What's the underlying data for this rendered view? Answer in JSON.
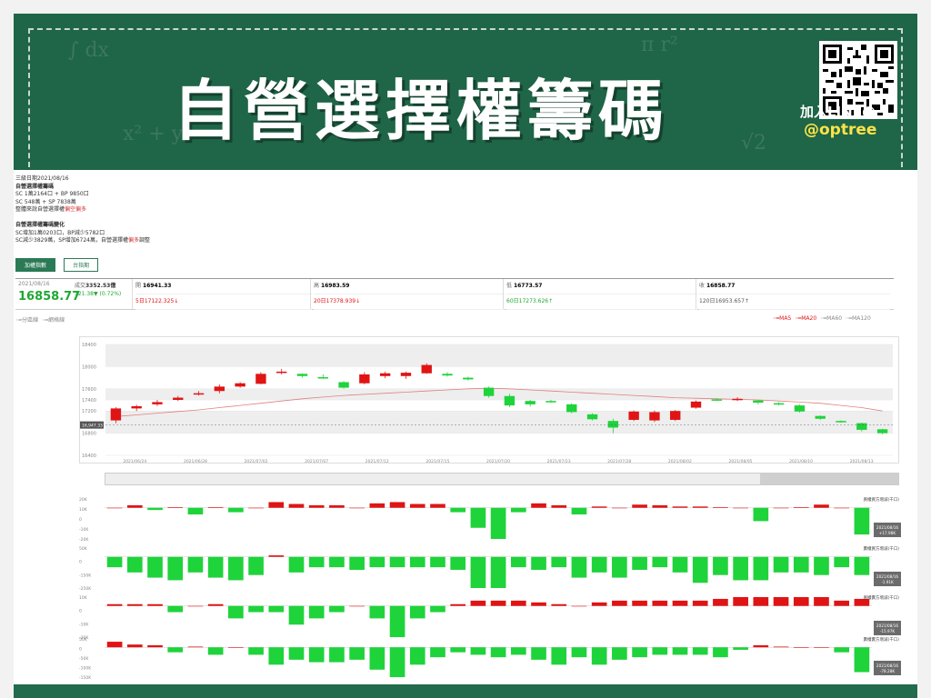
{
  "banner": {
    "title": "自營選擇權籌碼",
    "line_label": "加入LINE@",
    "line_id": "@optree"
  },
  "notes": {
    "date_line": "三級日期2021/08/16",
    "section1_title": "自營選擇權籌碼",
    "line_a": "SC 1萬2164口 + BP 9850口",
    "line_b": "SC 548萬 + SP 7838萬",
    "line_c_prefix": "整體來說自營選擇權",
    "line_c_red": "偏空偏多",
    "section2_title": "自營選擇權籌碼變化",
    "line_d": "SC增加1萬0203口，BP減少5782口",
    "line_e_prefix": "SC減少3829萬，SP增加6724萬，自營選擇權",
    "line_e_red": "偏多",
    "line_e_suffix": "調整"
  },
  "tabs": [
    "加權指數",
    "台指期"
  ],
  "stats": {
    "date": "2021/08/16",
    "price": "16858.77",
    "volume_label": "成交",
    "volume": "3352.53億",
    "change": "121.38▼ (0.72%)",
    "open_label": "開",
    "open": "16941.33",
    "high_label": "高",
    "high": "16983.59",
    "low_label": "低",
    "low": "16773.57",
    "close_label": "收",
    "close": "16858.77",
    "ma5": "5日17122.325↓",
    "ma20": "20日17378.939↓",
    "ma60": "60日17273.626↑",
    "ma120": "120日16953.657↑"
  },
  "toggles": {
    "left": [
      "分區線",
      "網格線"
    ],
    "right": [
      "MA5",
      "MA20",
      "MA60",
      "MA120"
    ]
  },
  "colors": {
    "up": "#e01414",
    "down": "#1fd33b",
    "ma": "#e08080",
    "brand": "#1f6547",
    "highlight": "#ffe347"
  },
  "chart_data": [
    {
      "type": "candlestick",
      "y_ticks": [
        "18400",
        "18000",
        "17600",
        "17400",
        "17200",
        "16800",
        "16400"
      ],
      "ylim": [
        16400,
        18400
      ],
      "price_tag": "16,947.33",
      "dates": [
        "2021/06/24",
        "2021/06/28",
        "2021/07/02",
        "2021/07/07",
        "2021/07/12",
        "2021/07/15",
        "2021/07/20",
        "2021/07/23",
        "2021/07/28",
        "2021/08/02",
        "2021/08/05",
        "2021/08/10",
        "2021/08/13"
      ],
      "candles": [
        [
          17030,
          17246,
          16980,
          17270
        ],
        [
          17246,
          17286,
          17200,
          17310
        ],
        [
          17320,
          17360,
          17290,
          17400
        ],
        [
          17400,
          17440,
          17380,
          17470
        ],
        [
          17510,
          17520,
          17480,
          17560
        ],
        [
          17560,
          17640,
          17520,
          17680
        ],
        [
          17640,
          17700,
          17620,
          17720
        ],
        [
          17690,
          17870,
          17680,
          17900
        ],
        [
          17900,
          17910,
          17860,
          17960
        ],
        [
          17870,
          17830,
          17800,
          17880
        ],
        [
          17810,
          17800,
          17780,
          17860
        ],
        [
          17720,
          17620,
          17600,
          17740
        ],
        [
          17700,
          17860,
          17680,
          17900
        ],
        [
          17830,
          17880,
          17790,
          17910
        ],
        [
          17830,
          17890,
          17780,
          17910
        ],
        [
          17880,
          18030,
          17870,
          18060
        ],
        [
          17870,
          17840,
          17820,
          17900
        ],
        [
          17800,
          17770,
          17750,
          17820
        ],
        [
          17620,
          17470,
          17440,
          17640
        ],
        [
          17470,
          17300,
          17270,
          17510
        ],
        [
          17380,
          17320,
          17280,
          17400
        ],
        [
          17380,
          17370,
          17350,
          17400
        ],
        [
          17320,
          17180,
          17160,
          17340
        ],
        [
          17140,
          17050,
          17030,
          17160
        ],
        [
          17020,
          16900,
          16800,
          17060
        ],
        [
          17040,
          17190,
          17020,
          17210
        ],
        [
          17030,
          17180,
          17000,
          17210
        ],
        [
          17040,
          17200,
          17020,
          17220
        ],
        [
          17260,
          17370,
          17240,
          17390
        ],
        [
          17410,
          17400,
          17380,
          17430
        ],
        [
          17420,
          17420,
          17380,
          17450
        ],
        [
          17390,
          17350,
          17320,
          17400
        ],
        [
          17340,
          17320,
          17300,
          17360
        ],
        [
          17300,
          17190,
          17170,
          17320
        ],
        [
          17110,
          17060,
          17040,
          17120
        ],
        [
          17020,
          17010,
          16990,
          17030
        ],
        [
          16980,
          16860,
          16830,
          16990
        ],
        [
          16870,
          16800,
          16780,
          16880
        ]
      ],
      "ma_line": [
        17100,
        17130,
        17160,
        17190,
        17220,
        17260,
        17300,
        17340,
        17380,
        17420,
        17450,
        17480,
        17500,
        17520,
        17540,
        17560,
        17580,
        17600,
        17610,
        17600,
        17580,
        17560,
        17540,
        17520,
        17500,
        17480,
        17460,
        17440,
        17430,
        17420,
        17410,
        17400,
        17380,
        17360,
        17340,
        17300,
        17260,
        17200
      ]
    },
    {
      "type": "bar",
      "title": "買權買方增減(千口)",
      "y_ticks": [
        "20K",
        "10K",
        "0",
        "-10K",
        "-20K"
      ],
      "ylim": [
        -20000,
        20000
      ],
      "tag": [
        "2021/08/16",
        "+17.98K"
      ],
      "values": [
        0,
        4,
        -1,
        1,
        -3,
        1,
        -2,
        0,
        9,
        6,
        4,
        4,
        0,
        7,
        9,
        6,
        6,
        -2,
        -9,
        -14,
        -2,
        7,
        4,
        -3,
        2,
        0,
        5,
        4,
        2,
        2,
        1,
        0,
        -6,
        0,
        1,
        5,
        0,
        -12
      ]
    },
    {
      "type": "bar",
      "title": "賣權買方增減(千口)",
      "y_ticks": [
        "50K",
        "0",
        "-150K",
        "-250K"
      ],
      "ylim": [
        -250000,
        50000
      ],
      "tag": [
        "2021/08/16",
        "-1.91K"
      ],
      "values": [
        -40,
        -60,
        -80,
        -90,
        -60,
        -80,
        -90,
        -70,
        20,
        -60,
        -40,
        -40,
        -50,
        -40,
        -40,
        -40,
        -40,
        -50,
        -120,
        -120,
        -40,
        -50,
        -40,
        -80,
        -60,
        -80,
        -50,
        -40,
        -60,
        -100,
        -70,
        -90,
        -90,
        -60,
        -60,
        -70,
        -40,
        -70
      ]
    },
    {
      "type": "bar",
      "title": "買權賣方增減(千口)",
      "y_ticks": [
        "10K",
        "0",
        "-10K",
        "-20K"
      ],
      "ylim": [
        -20000,
        10000
      ],
      "tag": [
        "2021/08/16",
        "-15.97K"
      ],
      "values": [
        1,
        1,
        1,
        -1,
        0,
        1,
        -2,
        -1,
        -1,
        -3,
        -2,
        -1,
        0,
        -2,
        -5,
        -2,
        -1,
        1,
        3,
        3,
        3,
        2,
        1,
        0,
        2,
        3,
        3,
        3,
        3,
        3,
        4,
        5,
        5,
        5,
        5,
        5,
        3,
        4
      ]
    },
    {
      "type": "bar",
      "title": "賣權賣方增減(千口)",
      "y_ticks": [
        "50K",
        "0",
        "-50K",
        "-100K",
        "-150K"
      ],
      "ylim": [
        -150000,
        50000
      ],
      "tag": [
        "2021/08/16",
        "-78.28K"
      ],
      "values": [
        40,
        20,
        15,
        -10,
        5,
        -15,
        0,
        -15,
        -35,
        -25,
        -30,
        -30,
        -25,
        -45,
        -60,
        -35,
        -20,
        -10,
        -15,
        -20,
        -15,
        -25,
        -35,
        -20,
        -35,
        -25,
        -20,
        -15,
        -15,
        -15,
        -20,
        -5,
        15,
        5,
        0,
        0,
        -10,
        -50
      ]
    }
  ]
}
